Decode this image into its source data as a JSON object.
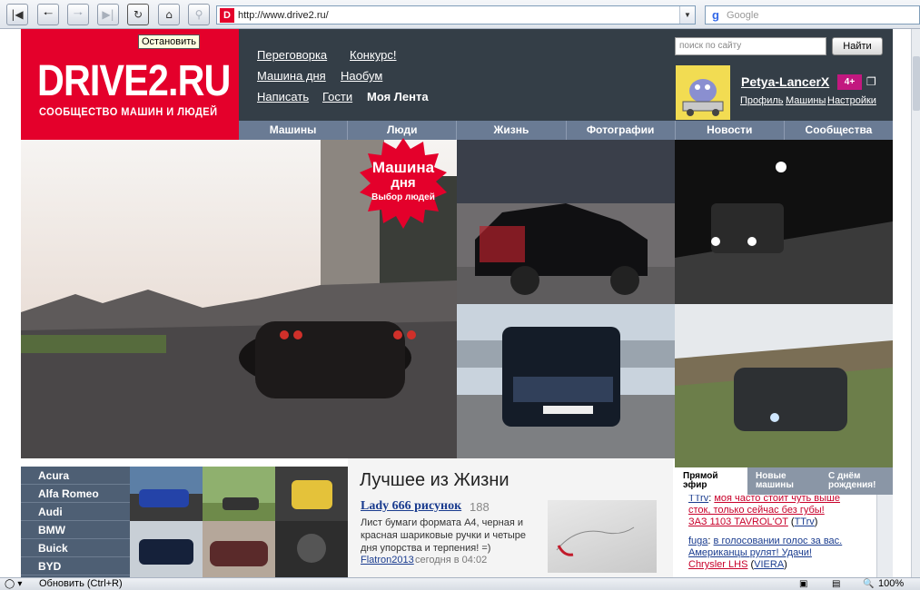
{
  "browser": {
    "url": "http://www.drive2.ru/",
    "search_engine": "Google",
    "tooltip": "Остановить",
    "status_text": "Обновить (Ctrl+R)",
    "zoom": "100%"
  },
  "site": {
    "logo_name": "DRIVE2.RU",
    "logo_tagline": "СООБЩЕСТВО МАШИН И ЛЮДЕЙ",
    "header_links": {
      "peregovorka": "Переговорка",
      "konkurs": "Конкурс!",
      "mashina_dnya": "Машина дня",
      "naobum": "Наобум",
      "napisat": "Написать",
      "gosti": "Гости",
      "moya_lenta": "Моя Лента"
    },
    "search_placeholder": "поиск по сайту",
    "search_button": "Найти",
    "user": {
      "name": "Petya-LancerX",
      "badge": "4+",
      "links": [
        "Профиль",
        "Машины",
        "Настройки"
      ]
    },
    "nav": [
      "Машины",
      "Люди",
      "Жизнь",
      "Фотографии",
      "Новости",
      "Сообщества"
    ],
    "motd_badge": [
      "Машина",
      "дня",
      "Выбор людей"
    ],
    "brands": [
      "Acura",
      "Alfa Romeo",
      "Audi",
      "BMW",
      "Buick",
      "BYD"
    ],
    "best": {
      "title": "Лучшее из Жизни",
      "post_title": "Lady 666 рисунок",
      "post_count": "188",
      "post_desc": "Лист бумаги формата А4, черная и красная шариковые ручки и четыре дня упорства и терпения! =)",
      "author": "Flatron2013",
      "time": "сегодня в 04:02"
    },
    "live_tabs": [
      "Прямой эфир",
      "Новые машины",
      "С днём рождения!"
    ],
    "live_feed": {
      "l1_user": "TTrv",
      "l1_text": "моя часто стоит чуть выше",
      "l2_text": "сток, только сейчас без губы!",
      "l3_car": "ЗАЗ 1103 TAVROL'OT",
      "l3_user": "TTrv",
      "l4_user": "fuga",
      "l4_text": "в голосовании голос за вас.",
      "l5_text": "Американцы рулят! Удачи!",
      "l6_car": "Chrysler LHS",
      "l6_user": "VIERA"
    }
  }
}
